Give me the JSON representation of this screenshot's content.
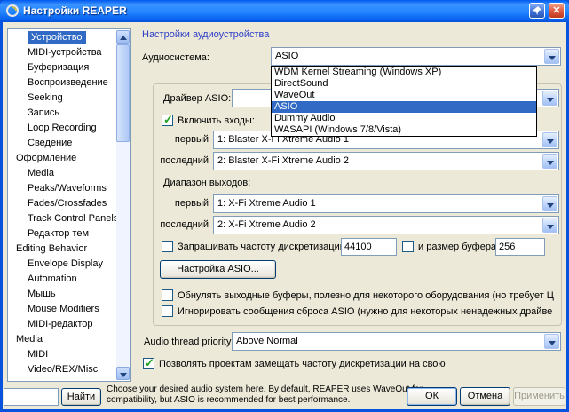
{
  "window": {
    "title": "Настройки REAPER"
  },
  "titlebar": {
    "close_glyph": "✕"
  },
  "sidebar": {
    "items": [
      {
        "label": "Устройство",
        "indent": 1,
        "selected": true
      },
      {
        "label": "MIDI-устройства",
        "indent": 1,
        "selected": false
      },
      {
        "label": "Буферизация",
        "indent": 1,
        "selected": false
      },
      {
        "label": "Воспроизведение",
        "indent": 1,
        "selected": false
      },
      {
        "label": "Seeking",
        "indent": 1,
        "selected": false
      },
      {
        "label": "Запись",
        "indent": 1,
        "selected": false
      },
      {
        "label": "Loop Recording",
        "indent": 1,
        "selected": false
      },
      {
        "label": "Сведение",
        "indent": 1,
        "selected": false
      },
      {
        "label": "Оформление",
        "indent": 0,
        "selected": false
      },
      {
        "label": "Media",
        "indent": 1,
        "selected": false
      },
      {
        "label": "Peaks/Waveforms",
        "indent": 1,
        "selected": false
      },
      {
        "label": "Fades/Crossfades",
        "indent": 1,
        "selected": false
      },
      {
        "label": "Track Control Panels",
        "indent": 1,
        "selected": false
      },
      {
        "label": "Редактор тем",
        "indent": 1,
        "selected": false
      },
      {
        "label": "Editing Behavior",
        "indent": 0,
        "selected": false
      },
      {
        "label": "Envelope Display",
        "indent": 1,
        "selected": false
      },
      {
        "label": "Automation",
        "indent": 1,
        "selected": false
      },
      {
        "label": "Мышь",
        "indent": 1,
        "selected": false
      },
      {
        "label": "Mouse Modifiers",
        "indent": 1,
        "selected": false
      },
      {
        "label": "MIDI-редактор",
        "indent": 1,
        "selected": false
      },
      {
        "label": "Media",
        "indent": 0,
        "selected": false
      },
      {
        "label": "MIDI",
        "indent": 1,
        "selected": false
      },
      {
        "label": "Video/REX/Misc",
        "indent": 1,
        "selected": false
      }
    ]
  },
  "main": {
    "section_title": "Настройки аудиоустройства",
    "audio_system_label": "Аудиосистема:",
    "audio_system_value": "ASIO",
    "audio_system_options": [
      "WDM Kernel Streaming (Windows XP)",
      "DirectSound",
      "WaveOut",
      "ASIO",
      "Dummy Audio",
      "WASAPI (Windows 7/8/Vista)"
    ],
    "audio_system_selected_index": 3,
    "asio": {
      "driver_label": "Драйвер ASIO:",
      "driver_value": "",
      "enable_inputs_label": "Включить входы:",
      "enable_inputs_checked": true,
      "first_label": "первый",
      "last_label": "последний",
      "input_first_value": "1: Blaster X-Fi Xtreme Audio 1",
      "input_last_value": "2: Blaster X-Fi Xtreme Audio 2",
      "output_range_label": "Диапазон выходов:",
      "output_first_value": "1: X-Fi Xtreme Audio 1",
      "output_last_value": "2: X-Fi Xtreme Audio 2",
      "request_srate_label": "Запрашивать частоту дискретизации:",
      "request_srate_checked": false,
      "srate_value": "44100",
      "bufsize_label": "и размер буфера:",
      "bufsize_checked": false,
      "bufsize_value": "256",
      "config_button": "Настройка ASIO...",
      "zero_buffers_label": "Обнулять выходные буферы, полезно для некоторого оборудования (но требует Ц",
      "zero_buffers_checked": false,
      "ignore_reset_label": "Игнорировать сообщения сброса ASIO (нужно для некоторых ненадежных драйве",
      "ignore_reset_checked": false
    },
    "thread_priority_label": "Audio thread priority:",
    "thread_priority_value": "Above Normal",
    "allow_override_label": "Позволять проектам замещать частоту дискретизации на свою",
    "allow_override_checked": true
  },
  "footer": {
    "search_value": "",
    "find_button": "Найти",
    "help_line1": "Choose your desired audio system here. By default, REAPER uses WaveOut for",
    "help_line2": "compatibility, but ASIO is recommended for best performance.",
    "ok_button": "ОК",
    "cancel_button": "Отмена",
    "apply_button": "Применить"
  }
}
